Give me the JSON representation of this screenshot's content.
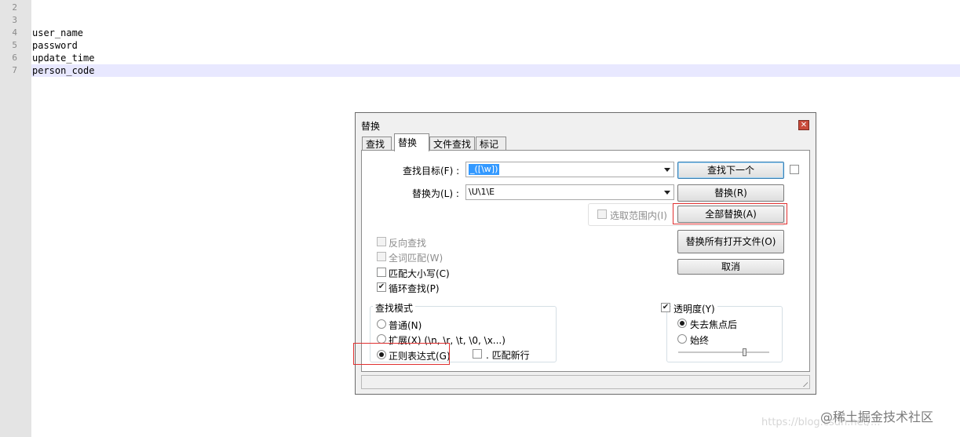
{
  "editor": {
    "line_numbers": [
      "2",
      "3",
      "4",
      "5",
      "6",
      "7"
    ],
    "lines": [
      "",
      "",
      "user_name",
      "password",
      "update_time",
      "person_code"
    ]
  },
  "dialog": {
    "title": "替换",
    "close_icon": "close-icon",
    "tabs": [
      "查找",
      "替换",
      "文件查找",
      "标记"
    ],
    "active_tab": "替换",
    "find_label": "查找目标(F) :",
    "find_value": "_([\\w])",
    "replace_label": "替换为(L) :",
    "replace_value": "\\U\\1\\E",
    "buttons": {
      "find_next": "查找下一个",
      "replace": "替换(R)",
      "replace_all": "全部替换(A)",
      "replace_all_open": "替换所有打开文件(O)",
      "cancel": "取消"
    },
    "in_selection": "选取范围内(I)",
    "options": {
      "backward": "反向查找",
      "whole_word": "全词匹配(W)",
      "match_case": "匹配大小写(C)",
      "wrap_around": "循环查找(P)"
    },
    "search_mode": {
      "title": "查找模式",
      "normal": "普通(N)",
      "extended": "扩展(X) (\\n, \\r, \\t, \\0, \\x...)",
      "regex": "正则表达式(G)",
      "dot_newline": ". 匹配新行"
    },
    "transparency": {
      "title": "透明度(Y)",
      "on_lose_focus": "失去焦点后",
      "always": "始终"
    }
  },
  "watermark": {
    "brand": "@稀土掘金技术社区",
    "url": "https://blog.csdn.net/..."
  }
}
